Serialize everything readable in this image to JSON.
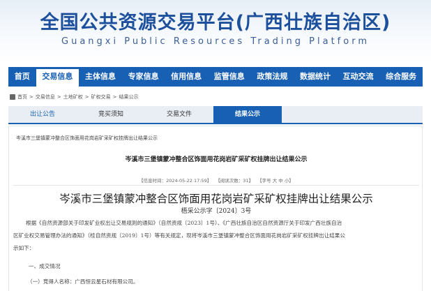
{
  "banner": {
    "title": "全国公共资源交易平台(广西壮族自治区)",
    "subtitle": "Guangxi Public Resources Trading Platform"
  },
  "nav": {
    "items": [
      {
        "label": "首页"
      },
      {
        "label": "交易信息"
      },
      {
        "label": "主体信息"
      },
      {
        "label": "专家信息"
      },
      {
        "label": "信用信息"
      },
      {
        "label": "监管信息"
      },
      {
        "label": "政策法规"
      },
      {
        "label": "数据统计"
      },
      {
        "label": "互动交流"
      },
      {
        "label": "综合服务"
      }
    ],
    "active_index": 1
  },
  "breadcrumb": {
    "items": [
      "首页",
      "交易信息",
      "土地矿权",
      "矿权交易",
      "结果公示"
    ],
    "separator": ">"
  },
  "tabs": [
    {
      "label": "出让公告"
    },
    {
      "label": "竞买须知"
    },
    {
      "label": "交易文件"
    },
    {
      "label": "结果公示"
    }
  ],
  "article": {
    "small_title": "岑溪市三堡镇蒙冲整合区饰面用花岗岩矿采矿权挂牌出让结果公示",
    "main_title": "岑溪市三堡镇蒙冲整合区饰面用花岗岩矿采矿权挂牌出让结果公示",
    "meta": {
      "time": "【信息时间：2024-05-22 17:59】",
      "views": "【阅读次数：31】",
      "font_size": "【字号 大 中 小】"
    },
    "doc_title": "岑溪市三堡镇蒙冲整合区饰面用花岗岩矿采矿权挂牌出让结果公示",
    "doc_number": "梧采公示字〔2024〕3号",
    "para1": "根据《自然资源部关于印发矿业权出让交易规则的通知》（自然资规〔2023〕1号）、《广西壮族自治区自然资源厅关于印发广西壮族自治",
    "para2": "区矿业权交易管理办法的通知》（桂自然资规〔2019〕1号）等有关规定，现将岑溪市三堡镇蒙冲整合区饰面用花岗岩矿采矿权挂牌出让结果公",
    "para3": "示如下：",
    "section1": "一、成交情况",
    "item1": "（一）竞得人名称：广西恒云星石材有限公司。"
  },
  "colors": {
    "nav_blue": "#1760b4",
    "title_blue": "#1c4f9c"
  }
}
